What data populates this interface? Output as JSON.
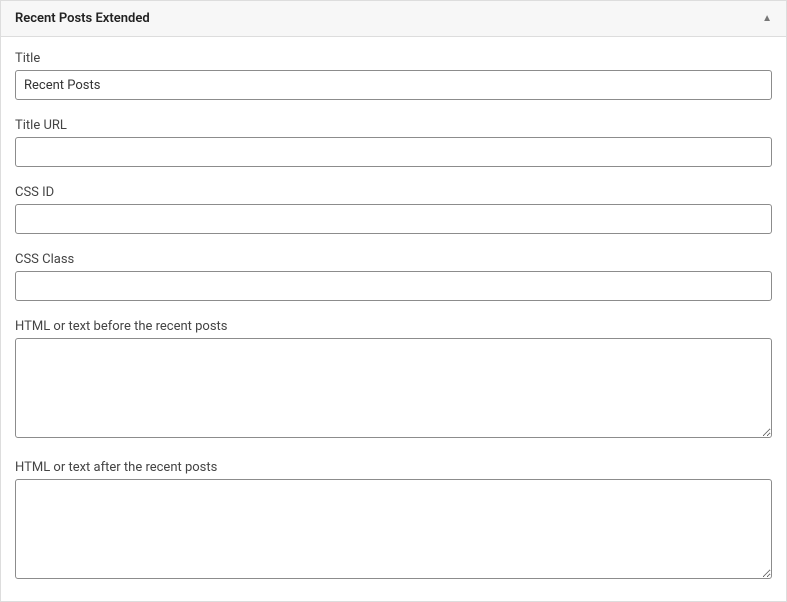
{
  "header": {
    "title": "Recent Posts Extended"
  },
  "fields": {
    "title": {
      "label": "Title",
      "value": "Recent Posts"
    },
    "title_url": {
      "label": "Title URL",
      "value": ""
    },
    "css_id": {
      "label": "CSS ID",
      "value": ""
    },
    "css_class": {
      "label": "CSS Class",
      "value": ""
    },
    "before": {
      "label": "HTML or text before the recent posts",
      "value": ""
    },
    "after": {
      "label": "HTML or text after the recent posts",
      "value": ""
    }
  }
}
